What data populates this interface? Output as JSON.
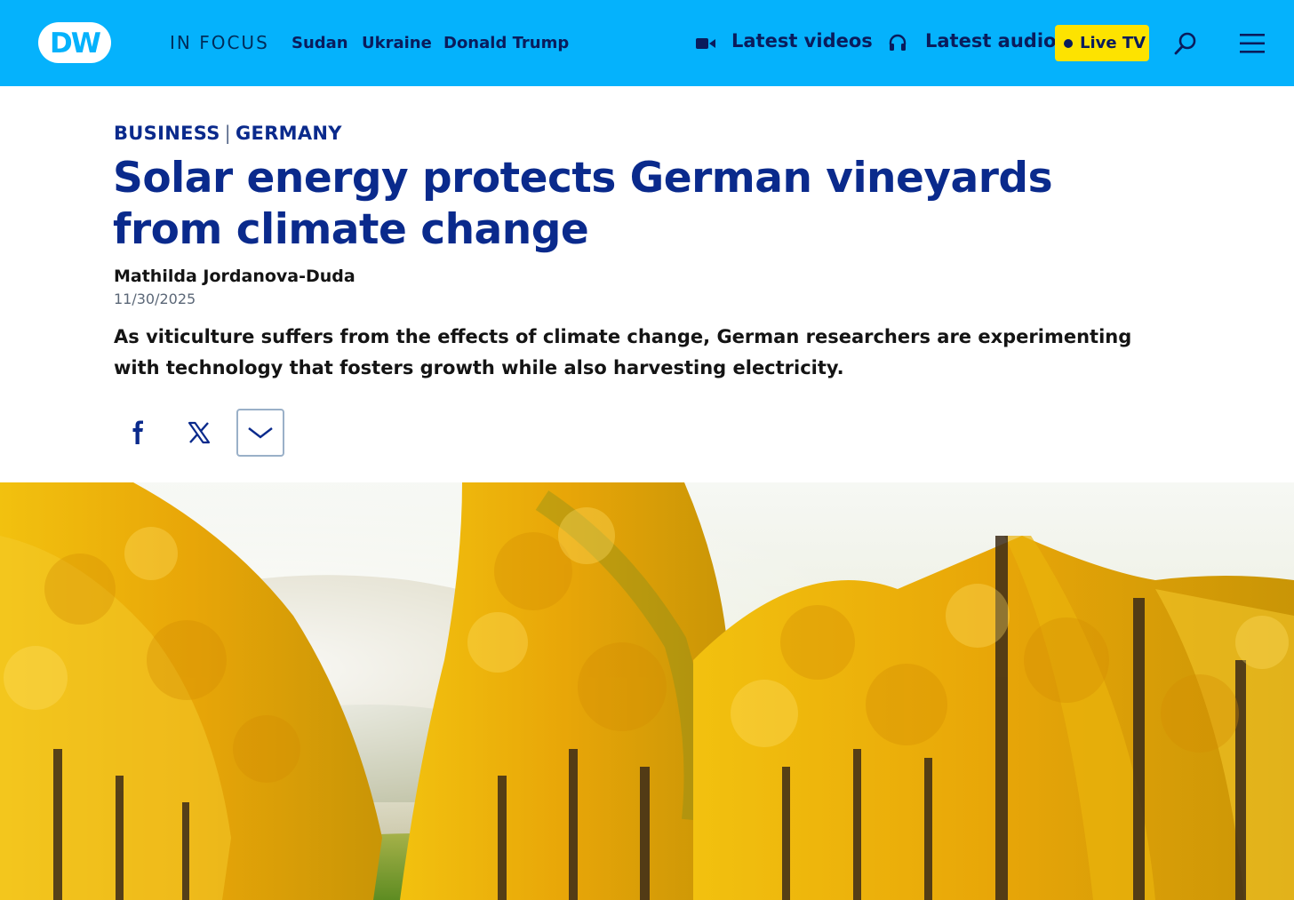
{
  "header": {
    "logo_text": "DW",
    "in_focus_label": "IN FOCUS",
    "topics": [
      {
        "label": "Sudan"
      },
      {
        "label": "Ukraine"
      },
      {
        "label": "Donald Trump"
      }
    ],
    "latest_videos_label": "Latest videos",
    "latest_audio_label": "Latest audio",
    "live_tv_label": "Live TV",
    "colors": {
      "bar": "#05b2fc",
      "live_tv": "#fde300",
      "text": "#0a1c5c"
    }
  },
  "article": {
    "category": "BUSINESS",
    "country": "GERMANY",
    "separator": "|",
    "headline": "Solar energy protects German vineyards from climate change",
    "author": "Mathilda Jordanova-Duda",
    "date": "11/30/2025",
    "teaser": "As viticulture suffers from the effects of climate change, German researchers are experimenting with technology that fosters growth while also harvesting electricity.",
    "colors": {
      "headline": "#0a2a8c"
    }
  },
  "share": {
    "icons": [
      "facebook-icon",
      "x-icon",
      "chevron-down-icon"
    ]
  }
}
